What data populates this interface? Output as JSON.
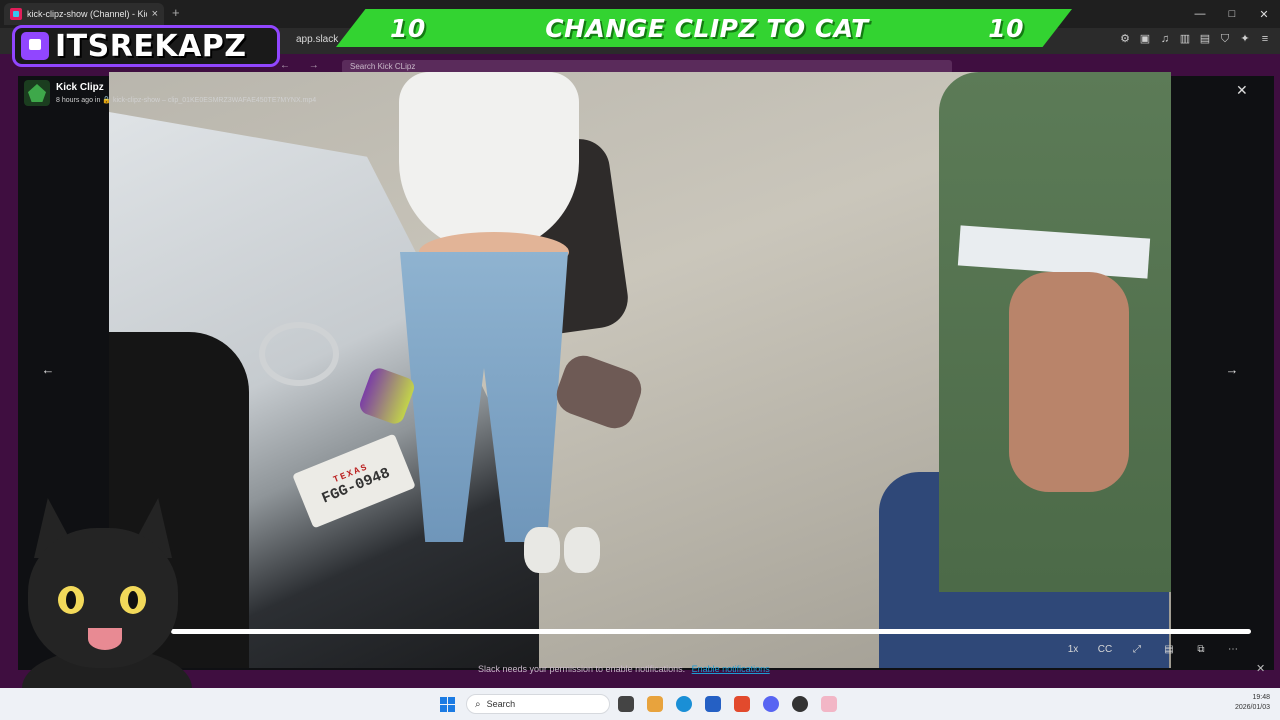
{
  "browser": {
    "tab_title": "kick-clipz-show (Channel) - Kick",
    "tab_close": "×",
    "new_tab": "+",
    "url": "app.slack",
    "win_controls": [
      "—",
      "□",
      "✕"
    ]
  },
  "overlay": {
    "banner_left_count": "10",
    "banner_text": "CHANGE CLIPZ TO CAT",
    "banner_right_count": "10",
    "streamer_name": "ITSREKAPZ"
  },
  "slack": {
    "search_placeholder": "Search Kick CLipz",
    "nav_arrows": "← →",
    "notice_text": "Slack needs your permission to enable notifications.",
    "notice_link": "Enable notifications",
    "notice_close": "✕"
  },
  "viewer": {
    "sender": "Kick Clipz",
    "meta_line": "8 hours ago in 🔒 kick-clipz-show  –  clip_01KE0ESMRZ3WAFAE450TE7MYNX.mp4",
    "close": "✕",
    "prev": "←",
    "next": "→"
  },
  "player": {
    "progress": 1.0,
    "speed": "1x",
    "controls": [
      "1x",
      "CC",
      "⤢",
      "▤",
      "⧉",
      "⋯"
    ]
  },
  "video_text": {
    "plate_state": "TEXAS",
    "plate_number": "FGG-0948"
  },
  "taskbar": {
    "search_label": "Search",
    "time": "19:48",
    "date": "2026/01/03"
  },
  "colors": {
    "banner": "#33d331",
    "twitch": "#9146ff",
    "slack": "#3f0e40"
  }
}
